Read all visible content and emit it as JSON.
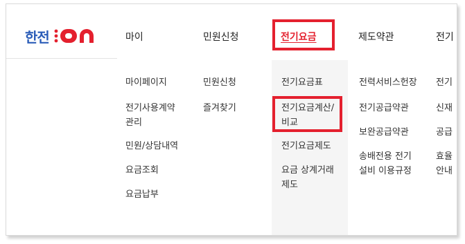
{
  "logo": {
    "text": "한전",
    "suffix": "ON",
    "brand_color": "#2b5db8",
    "accent_color": "#e4202e"
  },
  "nav": [
    {
      "label": "마이"
    },
    {
      "label": "민원신청"
    },
    {
      "label": "전기요금"
    },
    {
      "label": "제도약관"
    },
    {
      "label": "전기"
    }
  ],
  "menu": {
    "col1": [
      "마이페이지",
      "전기사용계약\n관리",
      "민원/상담내역",
      "요금조회",
      "요금납부"
    ],
    "col2": [
      "민원신청",
      "즐겨찾기"
    ],
    "col3": [
      "전기요금표",
      "전기요금계산/\n비교",
      "전기요금제도",
      "요금 상계거래\n제도"
    ],
    "col4": [
      "전력서비스헌장",
      "전기공급약관",
      "보완공급약관",
      "송배전용 전기\n설비 이용규정"
    ],
    "col5": [
      "전기",
      "신재",
      "공급",
      "효율\n안내"
    ]
  },
  "highlight_color": "#e4202e"
}
